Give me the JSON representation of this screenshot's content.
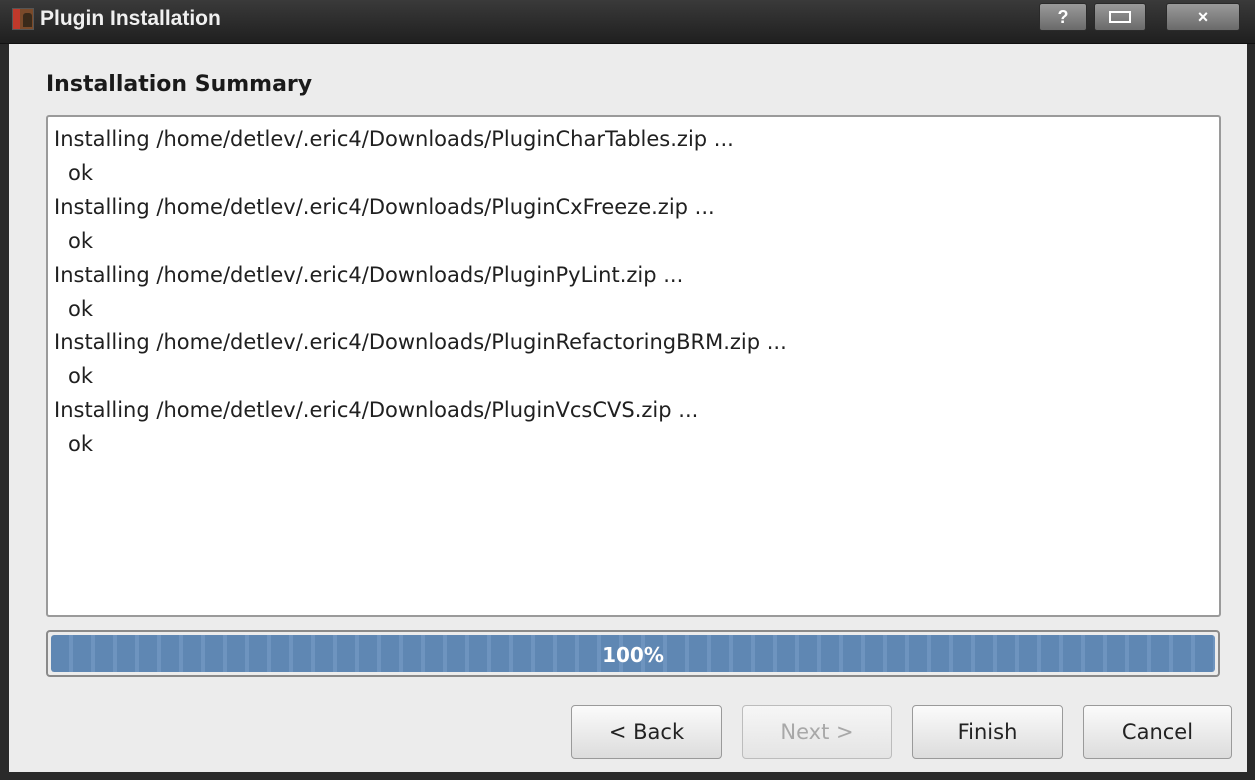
{
  "window": {
    "title": "Plugin Installation",
    "buttons": {
      "help": "?",
      "maximize": "",
      "close": "×"
    },
    "icon": "eric-app-icon"
  },
  "heading": "Installation Summary",
  "log": [
    "Installing /home/detlev/.eric4/Downloads/PluginCharTables.zip ...",
    "ok",
    "Installing /home/detlev/.eric4/Downloads/PluginCxFreeze.zip ...",
    "ok",
    "Installing /home/detlev/.eric4/Downloads/PluginPyLint.zip ...",
    "ok",
    "Installing /home/detlev/.eric4/Downloads/PluginRefactoringBRM.zip ...",
    "ok",
    "Installing /home/detlev/.eric4/Downloads/PluginVcsCVS.zip ...",
    "ok"
  ],
  "progress": {
    "value": 100,
    "text": "100%"
  },
  "buttons": {
    "back": "< Back",
    "next": "Next >",
    "finish": "Finish",
    "cancel": "Cancel"
  },
  "colors": {
    "progress_fill": "#5f87b3",
    "titlebar": "#2a2a2a",
    "dialog_bg": "#ececec"
  }
}
